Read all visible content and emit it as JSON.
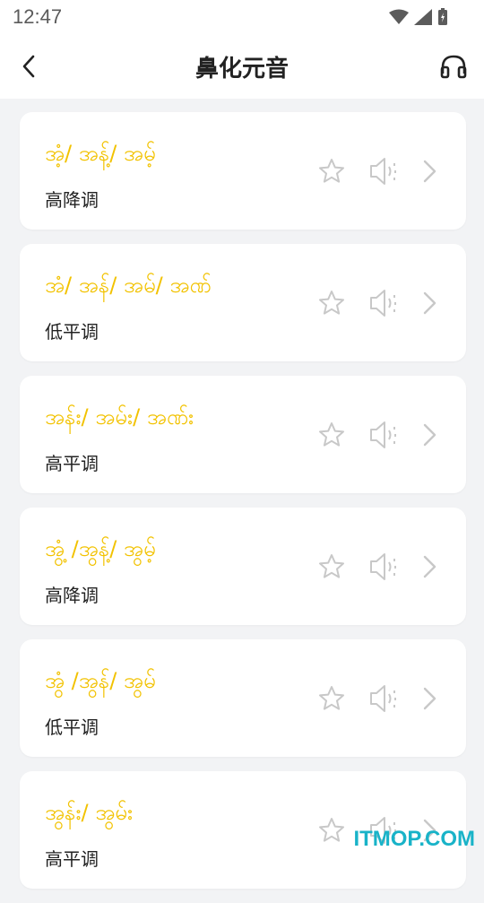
{
  "status": {
    "time": "12:47"
  },
  "header": {
    "title": "鼻化元音"
  },
  "items": [
    {
      "title": "အံ့/ အန့်/ အမ့်",
      "tone": "高降调"
    },
    {
      "title": "အံ/ အန်/ အမ်/ အဏ်",
      "tone": "低平调"
    },
    {
      "title": "အန်း/ အမ်း/ အဏ်း",
      "tone": "高平调"
    },
    {
      "title": "အွံ့ /အွန့်/ အွမ့်",
      "tone": "高降调"
    },
    {
      "title": "အွံ /အွန်/ အွမ်",
      "tone": "低平调"
    },
    {
      "title": "အွန်း/ အွမ်း",
      "tone": "高平调"
    }
  ],
  "watermark": "ITMOP.COM"
}
